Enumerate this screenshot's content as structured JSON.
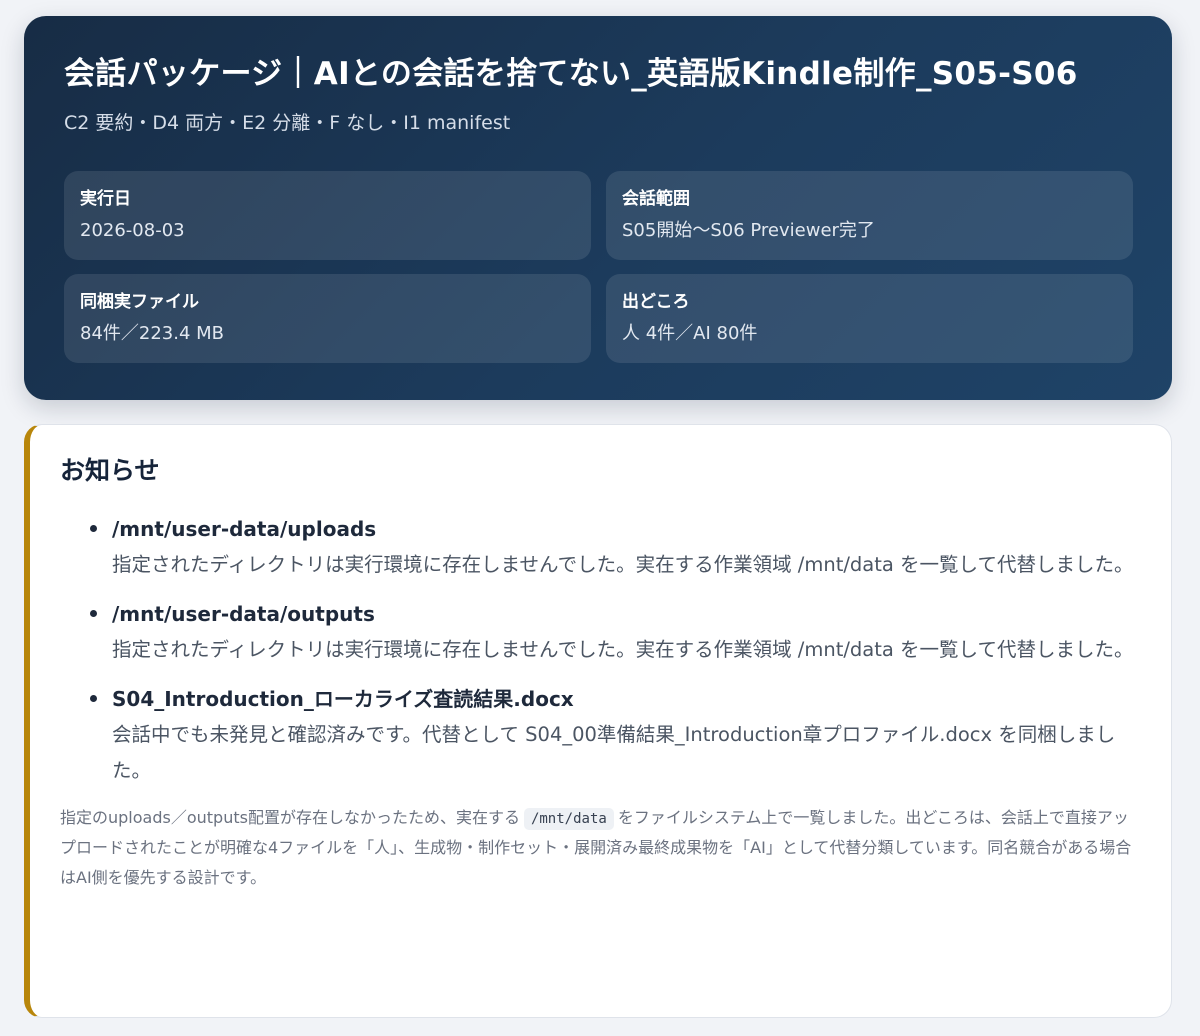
{
  "header": {
    "title": "会話パッケージ｜AIとの会話を捨てない_英語版Kindle制作_S05-S06",
    "subtitle": "C2 要約・D4 両方・E2 分離・F なし・I1 manifest",
    "meta": [
      {
        "label": "実行日",
        "value": "2026-08-03"
      },
      {
        "label": "会話範囲",
        "value": "S05開始～S06 Previewer完了"
      },
      {
        "label": "同梱実ファイル",
        "value": "84件／223.4 MB"
      },
      {
        "label": "出どころ",
        "value": "人 4件／AI 80件"
      }
    ]
  },
  "notice": {
    "title": "お知らせ",
    "items": [
      {
        "title": "/mnt/user-data/uploads",
        "description": "指定されたディレクトリは実行環境に存在しませんでした。実在する作業領域 /mnt/data を一覧して代替しました。"
      },
      {
        "title": "/mnt/user-data/outputs",
        "description": "指定されたディレクトリは実行環境に存在しませんでした。実在する作業領域 /mnt/data を一覧して代替しました。"
      },
      {
        "title": "S04_Introduction_ローカライズ査読結果.docx",
        "description": "会話中でも未発見と確認済みです。代替として S04_00準備結果_Introduction章プロファイル.docx を同梱しました。"
      }
    ],
    "note": {
      "before": "指定のuploads／outputs配置が存在しなかったため、実在する",
      "code": "/mnt/data",
      "after": "をファイルシステム上で一覧しました。出どころは、会話上で直接アップロードされたことが明確な4ファイルを「人」、生成物・制作セット・展開済み最終成果物を「AI」として代替分類しています。同名競合がある場合はAI側を優先する設計です。"
    }
  }
}
